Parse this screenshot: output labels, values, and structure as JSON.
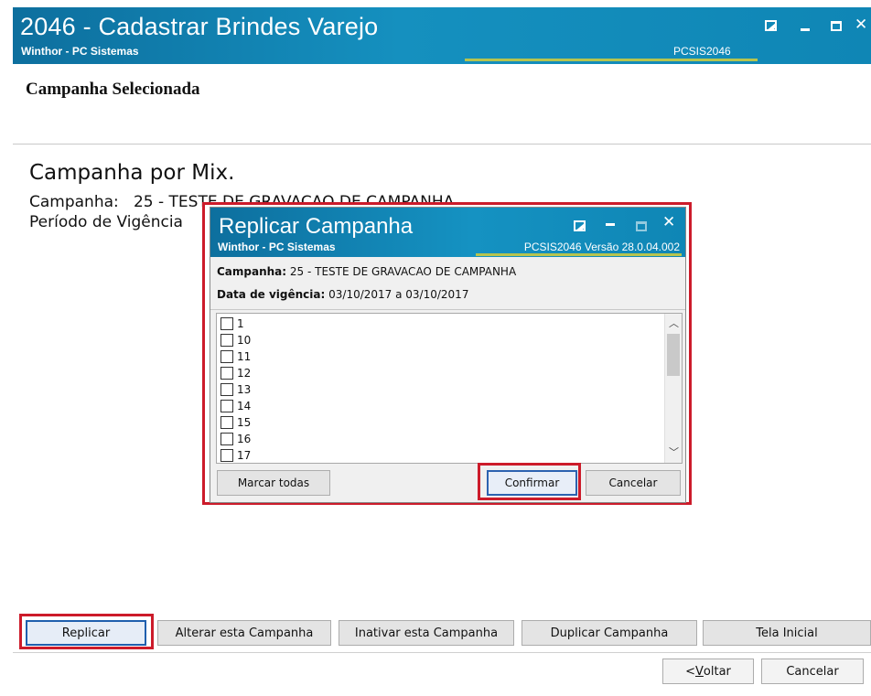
{
  "window": {
    "title": "2046 - Cadastrar Brindes Varejo",
    "subtitle": "Winthor - PC Sistemas",
    "code": "PCSIS2046"
  },
  "header": {
    "heading": "Campanha Selecionada"
  },
  "main": {
    "title": "Campanha por Mix.",
    "campanha_label": "Campanha:",
    "campanha_value": "25 - TESTE DE GRAVACAO DE CAMPANHA",
    "periodo_label": "Período de Vigência"
  },
  "actions": {
    "replicar": "Replicar",
    "alterar": "Alterar esta Campanha",
    "inativar": "Inativar esta Campanha",
    "duplicar": "Duplicar Campanha",
    "tela_inicial": "Tela Inicial"
  },
  "footer": {
    "voltar_prefix": "< ",
    "voltar_underlined": "V",
    "voltar_rest": "oltar",
    "cancelar": "Cancelar"
  },
  "dialog": {
    "title": "Replicar Campanha",
    "subtitle": "Winthor - PC Sistemas",
    "version": "PCSIS2046  Versão  28.0.04.002",
    "campanha_label": "Campanha:",
    "campanha_value": "25 - TESTE DE GRAVACAO DE CAMPANHA",
    "vigencia_label": "Data de vigência:",
    "vigencia_value": "03/10/2017 a 03/10/2017",
    "items": [
      "1",
      "10",
      "11",
      "12",
      "13",
      "14",
      "15",
      "16",
      "17"
    ],
    "marcar_todas": "Marcar todas",
    "confirmar": "Confirmar",
    "cancelar": "Cancelar"
  },
  "colors": {
    "titlebar": "#1590bf",
    "highlight": "#cc1b2a",
    "stripe": "#b6c44f"
  }
}
